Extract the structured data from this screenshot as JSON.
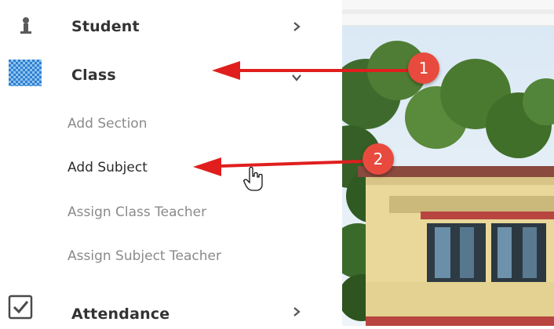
{
  "sidebar": {
    "items": [
      {
        "label": "Student",
        "icon": "student-icon",
        "chevron": "chevron-right-icon"
      },
      {
        "label": "Class",
        "icon": "checkered-icon",
        "chevron": "chevron-down-icon"
      },
      {
        "label": "Attendance",
        "icon": "checkbox-icon",
        "chevron": "chevron-right-icon"
      }
    ],
    "submenu": [
      {
        "label": "Add Section"
      },
      {
        "label": "Add Subject"
      },
      {
        "label": "Assign Class Teacher"
      },
      {
        "label": "Assign Subject Teacher"
      }
    ]
  },
  "annotations": [
    {
      "number": "1"
    },
    {
      "number": "2"
    }
  ],
  "colors": {
    "annotation_red": "#e84a3d",
    "muted_text": "#8a8a8a",
    "active_text": "#2b2b2b",
    "class_icon_blue": "#3a86d4"
  }
}
